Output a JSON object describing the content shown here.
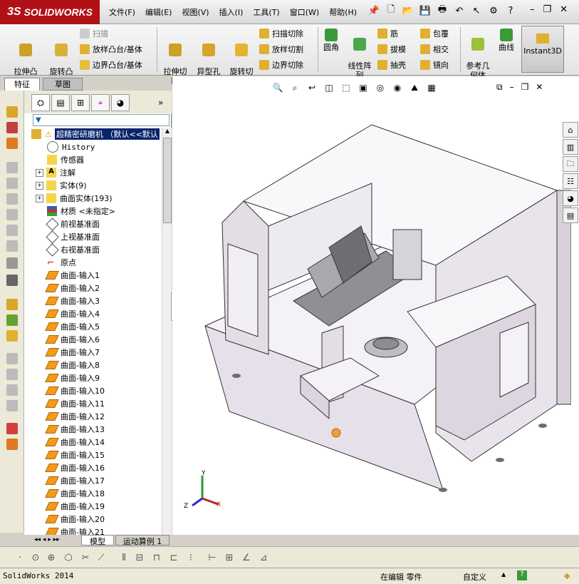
{
  "app": {
    "logo_text": "SOLIDWORKS",
    "logo_prefix": "3S"
  },
  "menu": [
    "文件(F)",
    "编辑(E)",
    "视图(V)",
    "插入(I)",
    "工具(T)",
    "窗口(W)",
    "帮助(H)"
  ],
  "ribbon": {
    "extrude_boss": "拉伸凸\n台/基体",
    "revolve_boss": "旋转凸\n台/基体",
    "sweep": "扫描",
    "loft_boss": "放样凸台/基体",
    "boundary_boss": "边界凸台/基体",
    "extrude_cut": "拉伸切\n除",
    "hole_wizard": "异型孔\n向导",
    "revolve_cut": "旋转切\n除",
    "swept_cut": "扫描切除",
    "lofted_cut": "放样切割",
    "boundary_cut": "边界切除",
    "fillet": "圆角",
    "linear_pattern": "线性阵\n列",
    "rib": "筋",
    "draft": "拔模",
    "shell": "抽壳",
    "wrap": "包覆",
    "intersect": "相交",
    "mirror": "镜向",
    "ref_geometry": "参考几\n何体",
    "curves": "曲线",
    "instant3d": "Instant3D"
  },
  "cm_tabs": {
    "features": "特征",
    "sketch": "草图"
  },
  "tree": {
    "root": "超精密研磨机 （默认<<默认",
    "history": "History",
    "sensors": "传感器",
    "annotations": "注解",
    "solid_bodies": "实体(9)",
    "surface_bodies": "曲面实体(193)",
    "material": "材质 <未指定>",
    "front_plane": "前视基准面",
    "top_plane": "上视基准面",
    "right_plane": "右视基准面",
    "origin": "原点",
    "surfaces": [
      "曲面-输入1",
      "曲面-输入2",
      "曲面-输入3",
      "曲面-输入4",
      "曲面-输入5",
      "曲面-输入6",
      "曲面-输入7",
      "曲面-输入8",
      "曲面-输入9",
      "曲面-输入10",
      "曲面-输入11",
      "曲面-输入12",
      "曲面-输入13",
      "曲面-输入14",
      "曲面-输入15",
      "曲面-输入16",
      "曲面-输入17",
      "曲面-输入18",
      "曲面-输入19",
      "曲面-输入20",
      "曲面-输入21"
    ]
  },
  "triad": {
    "x": "X",
    "y": "Y",
    "z": "Z"
  },
  "bottom_tabs": {
    "model": "模型",
    "motion": "运动算例 1"
  },
  "status": {
    "app_version": "SolidWorks 2014",
    "editing": "在编辑 零件",
    "custom": "自定义"
  },
  "colors": {
    "logo_bg": "#b11116",
    "surface_icon": "#f19a1c",
    "selection": "#0a246a"
  }
}
